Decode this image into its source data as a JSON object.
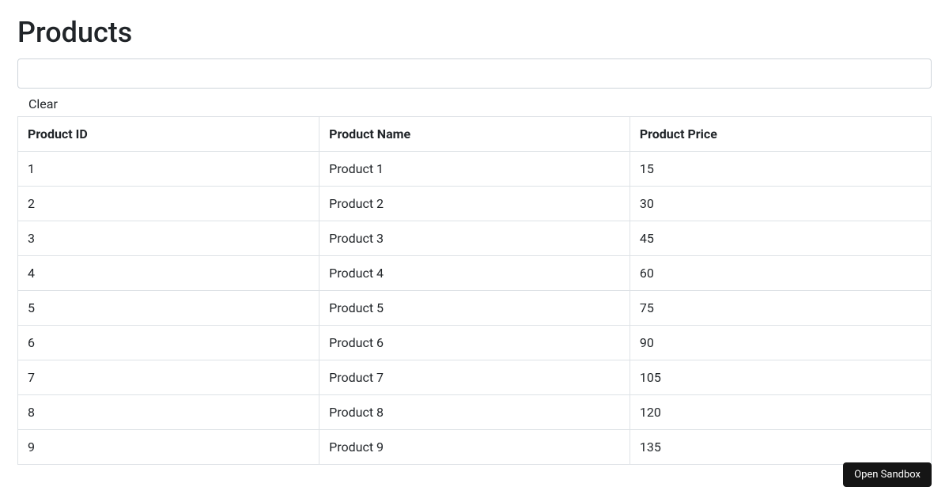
{
  "page": {
    "title": "Products"
  },
  "search": {
    "value": "",
    "placeholder": ""
  },
  "actions": {
    "clear_label": "Clear"
  },
  "table": {
    "headers": {
      "id": "Product ID",
      "name": "Product Name",
      "price": "Product Price"
    },
    "rows": [
      {
        "id": "1",
        "name": "Product 1",
        "price": "15"
      },
      {
        "id": "2",
        "name": "Product 2",
        "price": "30"
      },
      {
        "id": "3",
        "name": "Product 3",
        "price": "45"
      },
      {
        "id": "4",
        "name": "Product 4",
        "price": "60"
      },
      {
        "id": "5",
        "name": "Product 5",
        "price": "75"
      },
      {
        "id": "6",
        "name": "Product 6",
        "price": "90"
      },
      {
        "id": "7",
        "name": "Product 7",
        "price": "105"
      },
      {
        "id": "8",
        "name": "Product 8",
        "price": "120"
      },
      {
        "id": "9",
        "name": "Product 9",
        "price": "135"
      }
    ]
  },
  "sandbox": {
    "label": "Open Sandbox"
  }
}
